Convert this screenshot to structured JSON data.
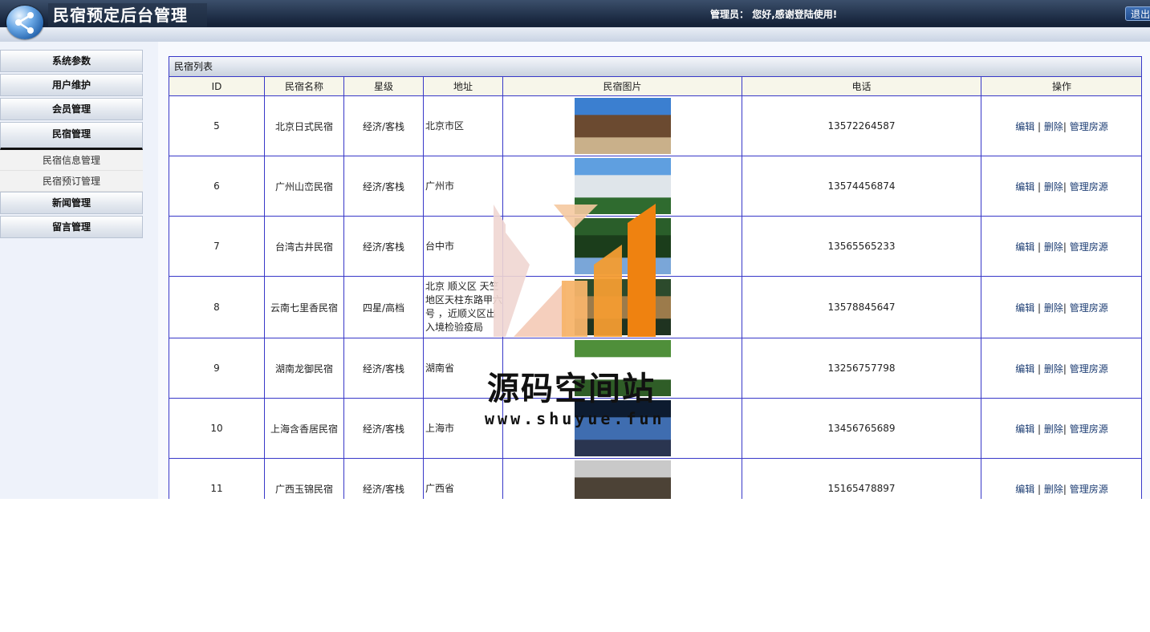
{
  "header": {
    "app_title": "民宿预定后台管理",
    "admin_label": "管理员：",
    "greeting": "您好,感谢登陆使用!",
    "logout_label": "退出"
  },
  "sidebar": {
    "menus": [
      {
        "label": "系统参数"
      },
      {
        "label": "用户维护"
      },
      {
        "label": "会员管理"
      },
      {
        "label": "民宿管理"
      }
    ],
    "submenus": [
      {
        "label": "民宿信息管理"
      },
      {
        "label": "民宿预订管理"
      }
    ],
    "menus_after": [
      {
        "label": "新闻管理"
      },
      {
        "label": "留言管理"
      }
    ]
  },
  "panel": {
    "title": "民宿列表",
    "columns": [
      "ID",
      "民宿名称",
      "星级",
      "地址",
      "民宿图片",
      "电话",
      "操作"
    ],
    "actions": {
      "edit": "编辑",
      "sep": "|",
      "delete": "删除",
      "rooms": "管理房源"
    },
    "rows": [
      {
        "id": "5",
        "name": "北京日式民宿",
        "star": "经济/客栈",
        "addr": "北京市区",
        "phone": "13572264587"
      },
      {
        "id": "6",
        "name": "广州山峦民宿",
        "star": "经济/客栈",
        "addr": "广州市",
        "phone": "13574456874"
      },
      {
        "id": "7",
        "name": "台湾古井民宿",
        "star": "经济/客栈",
        "addr": "台中市",
        "phone": "13565565233"
      },
      {
        "id": "8",
        "name": "云南七里香民宿",
        "star": "四星/高档",
        "addr": "北京 顺义区 天竺地区天柱东路甲六号 ，近顺义区出入境检验疫局",
        "phone": "13578845647"
      },
      {
        "id": "9",
        "name": "湖南龙御民宿",
        "star": "经济/客栈",
        "addr": "湖南省",
        "phone": "13256757798"
      },
      {
        "id": "10",
        "name": "上海含香居民宿",
        "star": "经济/客栈",
        "addr": "上海市",
        "phone": "13456765689"
      },
      {
        "id": "11",
        "name": "广西玉锦民宿",
        "star": "经济/客栈",
        "addr": "广西省",
        "phone": "15165478897"
      }
    ]
  },
  "watermark": {
    "text": "源码空间站",
    "url": "www.shuyue.fun"
  }
}
